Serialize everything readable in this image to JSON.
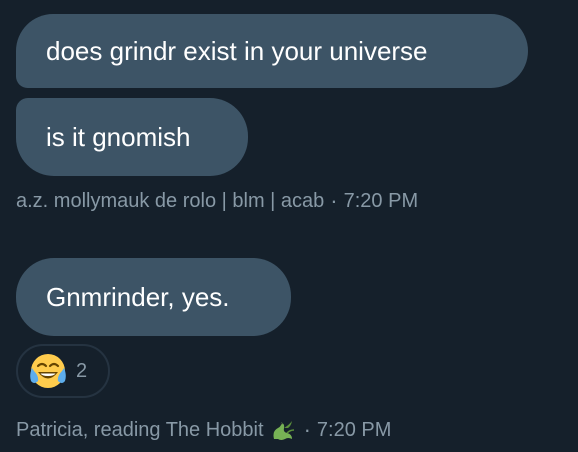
{
  "messages": [
    {
      "text": "does grindr exist in your universe"
    },
    {
      "text": "is it gnomish"
    }
  ],
  "meta1": {
    "sender": "a.z. mollymauk de rolo | blm | acab",
    "separator": "·",
    "time": "7:20 PM"
  },
  "reply": {
    "text": "Gnmrinder, yes.",
    "reaction": {
      "emoji": "face-with-tears-of-joy",
      "count": "2"
    }
  },
  "meta2": {
    "sender": "Patricia, reading The Hobbit",
    "sender_icon": "dragon-icon",
    "separator": "·",
    "time": "7:20 PM"
  },
  "colors": {
    "background": "#15202b",
    "bubble": "#3d5466",
    "meta_text": "#8899a6",
    "reaction_border": "#253341"
  }
}
